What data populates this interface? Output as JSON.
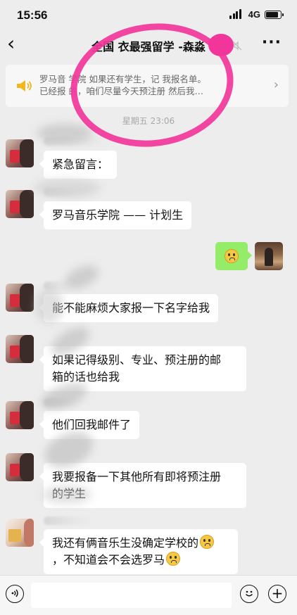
{
  "status_bar": {
    "time": "15:56",
    "network": "4G"
  },
  "nav": {
    "back_icon": "chevron-left-icon",
    "title": "全国 衣最强留学 -森淼",
    "more_label": "···"
  },
  "notice": {
    "line1": "罗马音 学院 如果还有学生，记 我报名单。",
    "line2": "已经报 的，咱们尽量今天预注册 然后我…",
    "arrow": "›",
    "icon": "speaker-icon"
  },
  "timestamp": "星期五 23:06",
  "messages": [
    {
      "from": "other",
      "text": "紧急留言："
    },
    {
      "from": "other",
      "text": "罗马音乐学院 —— 计划生"
    },
    {
      "from": "me",
      "emoji": "flushed-face-emoji"
    },
    {
      "from": "other",
      "text": "能不能麻烦大家报一下名字给我"
    },
    {
      "from": "other",
      "text_lines": [
        "如果记得级别、专业、预注册的邮",
        "箱的话也给我"
      ]
    },
    {
      "from": "other",
      "text": "他们回我邮件了"
    },
    {
      "from": "other",
      "text_lines": [
        "我要报备一下其他所有即将预注册",
        "的学生"
      ]
    },
    {
      "from": "other",
      "text_lines": [
        "我还有俩音乐生没确定学校的",
        "，不知道会不会选罗马"
      ]
    }
  ],
  "input_bar": {
    "voice_icon": "voice-icon",
    "emoji_icon": "emoji-icon",
    "plus_icon": "plus-icon"
  }
}
